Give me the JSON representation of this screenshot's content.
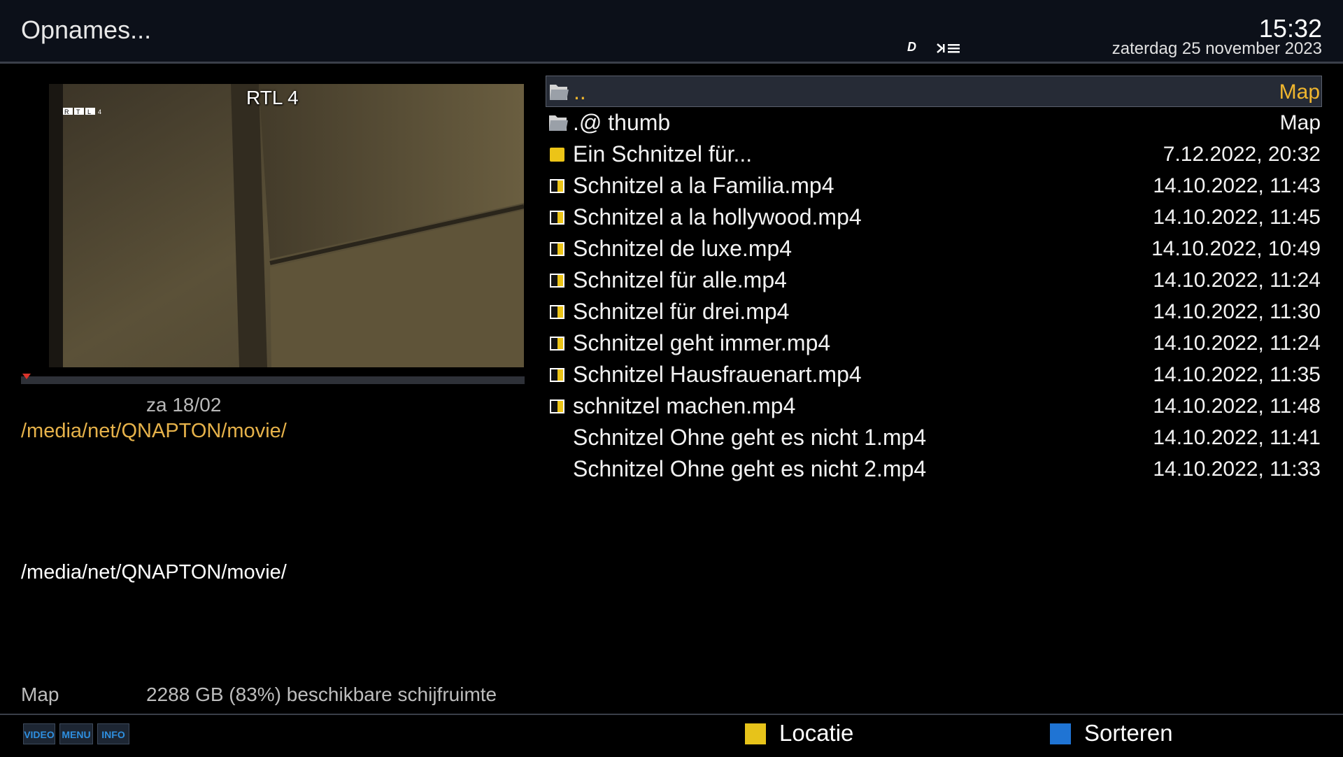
{
  "header": {
    "title": "Opnames...",
    "clock": "15:32",
    "date": "zaterdag 25 november 2023",
    "indicators": [
      "dolby-icon",
      "skip-list-icon"
    ],
    "dolby_glyph": "D"
  },
  "preview": {
    "channel": "RTL 4",
    "logo_text": "RTL 4",
    "recording_date": "za 18/02",
    "path_highlight": "/media/net/QNAPTON/movie/",
    "path": "/media/net/QNAPTON/movie/",
    "type_label": "Map",
    "free_space": "2288 GB (83%) beschikbare schijfruimte"
  },
  "file_list": [
    {
      "name": "..",
      "meta": "Map",
      "icon": "folder-icon",
      "selected": true
    },
    {
      "name": ".@  thumb",
      "meta": "Map",
      "icon": "folder-icon"
    },
    {
      "name": "Ein Schnitzel für...",
      "meta": "7.12.2022, 20:32",
      "icon": "unwatched-icon"
    },
    {
      "name": "Schnitzel a la Familia.mp4",
      "meta": "14.10.2022, 11:43",
      "icon": "partially-watched-icon"
    },
    {
      "name": "Schnitzel a la hollywood.mp4",
      "meta": "14.10.2022, 11:45",
      "icon": "partially-watched-icon"
    },
    {
      "name": "Schnitzel de luxe.mp4",
      "meta": "14.10.2022, 10:49",
      "icon": "partially-watched-icon"
    },
    {
      "name": "Schnitzel für alle.mp4",
      "meta": "14.10.2022, 11:24",
      "icon": "partially-watched-icon"
    },
    {
      "name": "Schnitzel für drei.mp4",
      "meta": "14.10.2022, 11:30",
      "icon": "partially-watched-icon"
    },
    {
      "name": "Schnitzel geht immer.mp4",
      "meta": "14.10.2022, 11:24",
      "icon": "partially-watched-icon"
    },
    {
      "name": "Schnitzel Hausfrauenart.mp4",
      "meta": "14.10.2022, 11:35",
      "icon": "partially-watched-icon"
    },
    {
      "name": "schnitzel machen.mp4",
      "meta": "14.10.2022, 11:48",
      "icon": "partially-watched-icon"
    },
    {
      "name": "Schnitzel Ohne geht es nicht 1.mp4",
      "meta": "14.10.2022, 11:41",
      "icon": "none"
    },
    {
      "name": "Schnitzel Ohne geht es nicht 2.mp4",
      "meta": "14.10.2022, 11:33",
      "icon": "none"
    }
  ],
  "footer": {
    "key_video": "VIDEO",
    "key_menu": "MENU",
    "key_info": "INFO",
    "yellow_label": "Locatie",
    "blue_label": "Sorteren"
  },
  "colors": {
    "accent_yellow": "#f0b62e",
    "path_yellow": "#e6b24a",
    "blue_key": "#1f74d4",
    "yellow_key": "#e7c31a"
  }
}
